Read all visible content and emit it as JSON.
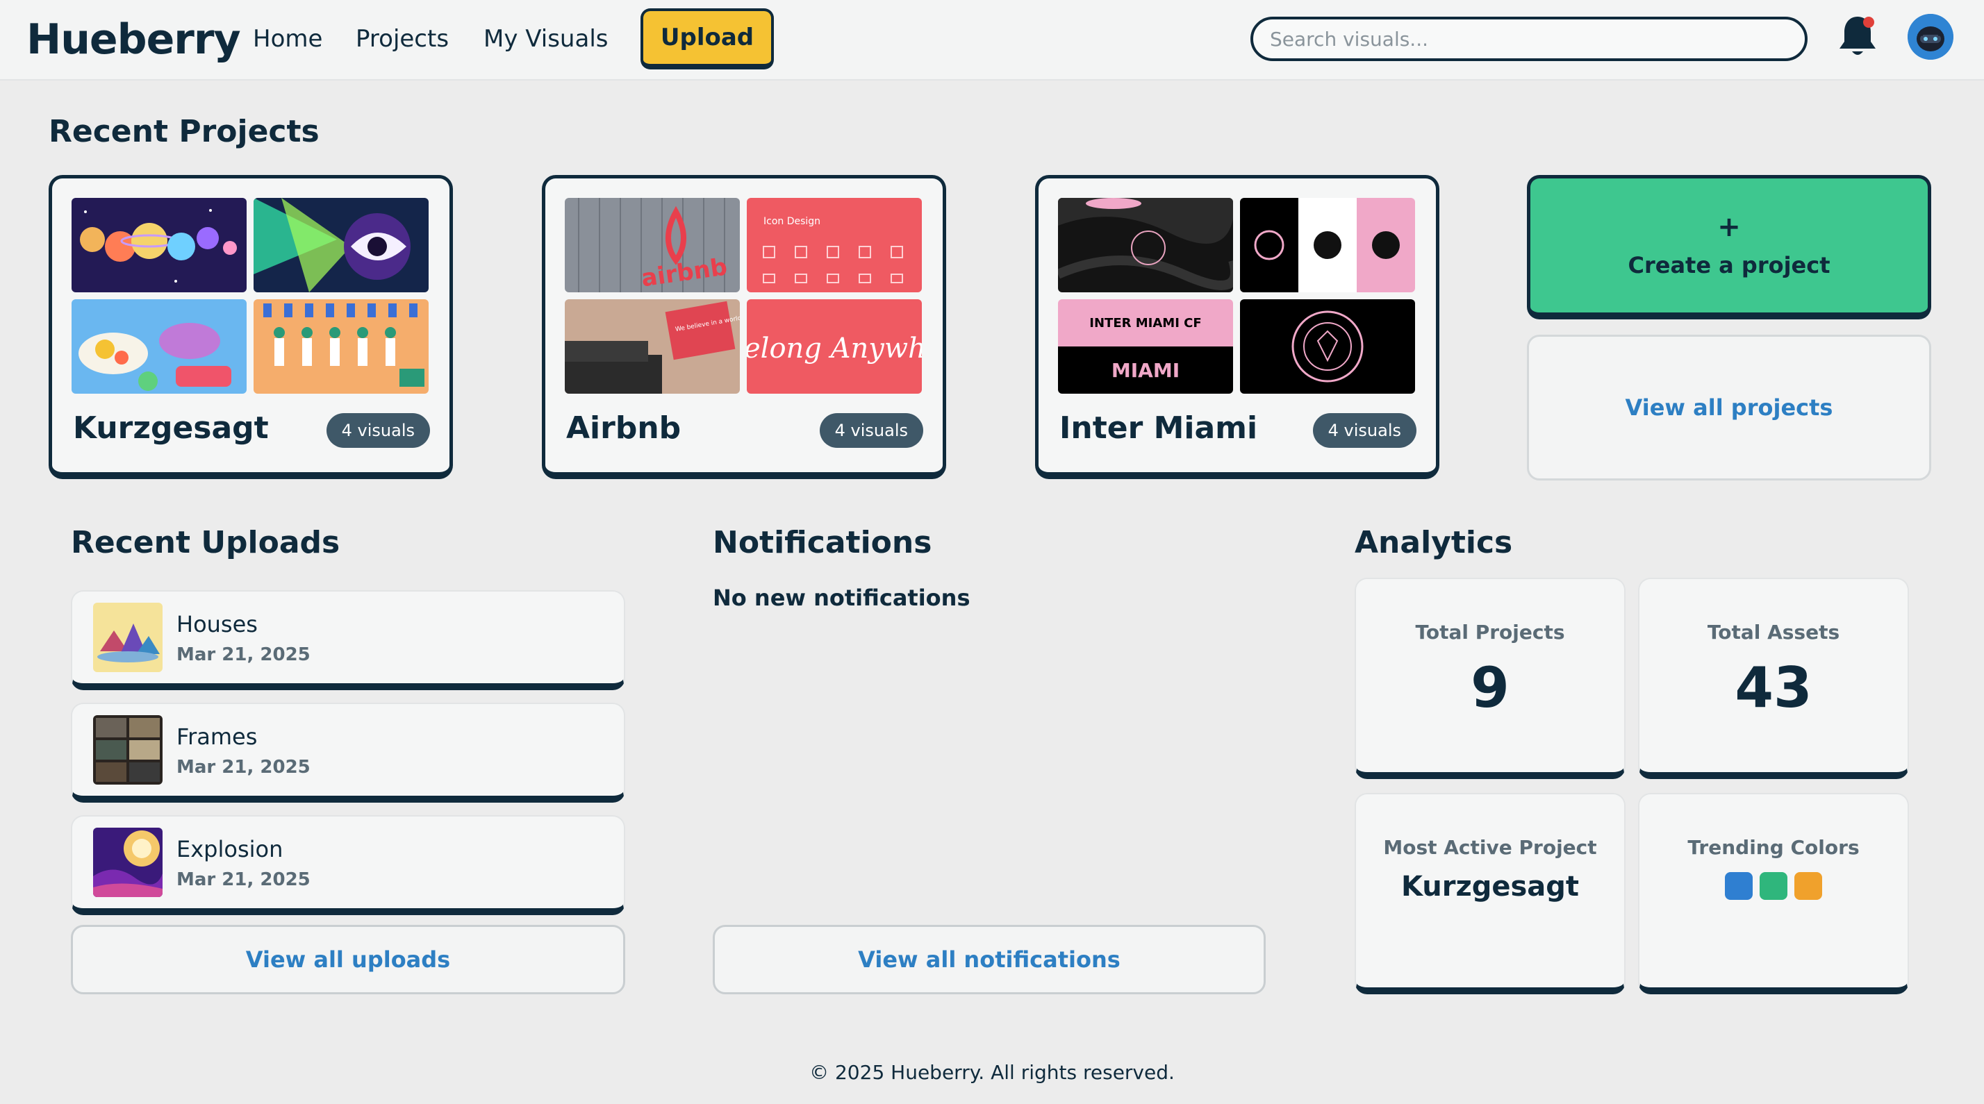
{
  "header": {
    "logo": "Hueberry",
    "nav": [
      "Home",
      "Projects",
      "My Visuals"
    ],
    "upload_label": "Upload",
    "search_placeholder": "Search visuals...",
    "bell_icon": "bell-icon",
    "avatar_icon": "avatar"
  },
  "recent_projects": {
    "title": "Recent Projects",
    "items": [
      {
        "name": "Kurzgesagt",
        "badge": "4 visuals"
      },
      {
        "name": "Airbnb",
        "badge": "4 visuals",
        "thumb_text_1": "Icon Design",
        "thumb_text_2": "elong Anywher",
        "thumb_text_3": "We believe in a world where people belong anywhere."
      },
      {
        "name": "Inter Miami",
        "badge": "4 visuals",
        "thumb_text_1": "INTER MIAMI CF",
        "thumb_text_2": "MIAMI"
      }
    ],
    "create_label": "Create a project",
    "create_plus": "+",
    "view_all_label": "View all projects"
  },
  "recent_uploads": {
    "title": "Recent Uploads",
    "items": [
      {
        "title": "Houses",
        "date": "Mar 21, 2025"
      },
      {
        "title": "Frames",
        "date": "Mar 21, 2025"
      },
      {
        "title": "Explosion",
        "date": "Mar 21, 2025"
      }
    ],
    "view_all_label": "View all uploads"
  },
  "notifications": {
    "title": "Notifications",
    "empty_text": "No new notifications",
    "view_all_label": "View all notifications"
  },
  "analytics": {
    "title": "Analytics",
    "total_projects_label": "Total Projects",
    "total_projects_value": "9",
    "total_assets_label": "Total Assets",
    "total_assets_value": "43",
    "most_active_label": "Most Active Project",
    "most_active_value": "Kurzgesagt",
    "trending_label": "Trending Colors",
    "trending_colors": [
      "#2f7fd1",
      "#2fb67c",
      "#f0a12c"
    ]
  },
  "footer": "© 2025 Hueberry. All rights reserved.",
  "colors": {
    "brand_dark": "#0f2a3c",
    "accent_yellow": "#f5c233",
    "accent_green": "#3ec78f",
    "link_blue": "#2d7fc3"
  }
}
